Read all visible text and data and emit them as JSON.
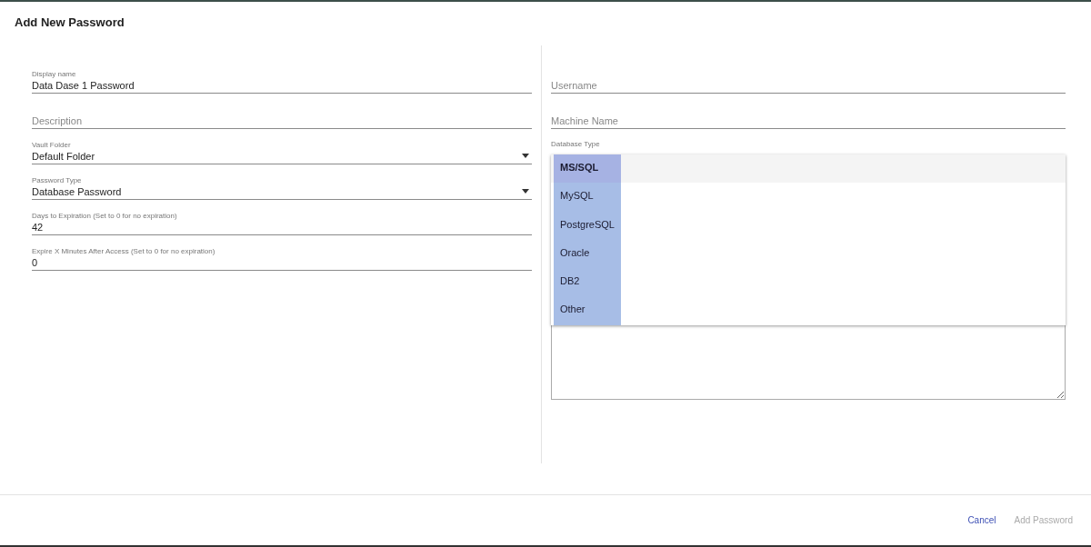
{
  "dialog": {
    "title": "Add New Password"
  },
  "left_fields": [
    {
      "kind": "text",
      "label": "Display name",
      "value": "Data Dase 1 Password"
    },
    {
      "kind": "text",
      "placeholder": "Description"
    },
    {
      "kind": "select",
      "label": "Vault Folder",
      "value": "Default Folder"
    },
    {
      "kind": "select",
      "label": "Password Type",
      "value": "Database Password"
    },
    {
      "kind": "text",
      "label": "Days to Expiration (Set to 0 for no expiration)",
      "value": "42"
    },
    {
      "kind": "text",
      "label": "Expire X Minutes After Access (Set to 0 for no expiration)",
      "value": "0"
    }
  ],
  "right_fields": [
    {
      "kind": "text",
      "placeholder": "Username"
    },
    {
      "kind": "text",
      "placeholder": "Machine Name"
    },
    {
      "kind": "select",
      "label": "Database Type"
    }
  ],
  "database_type_menu": [
    {
      "label": "MS/SQL",
      "selected": true
    },
    {
      "label": "MySQL",
      "selected": false
    },
    {
      "label": "PostgreSQL",
      "selected": false
    },
    {
      "label": "Oracle",
      "selected": false
    },
    {
      "label": "DB2",
      "selected": false
    },
    {
      "label": "Other",
      "selected": false
    }
  ],
  "buttons": [
    {
      "label": "Cancel",
      "disabled": false
    },
    {
      "label": "Add Password",
      "disabled": true
    }
  ]
}
